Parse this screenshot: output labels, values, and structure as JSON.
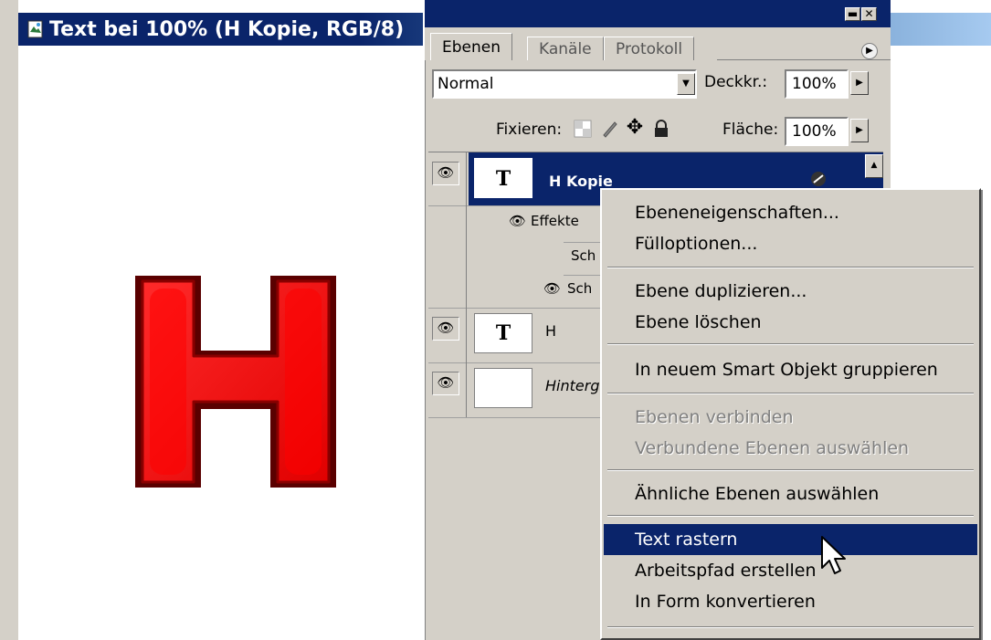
{
  "document": {
    "title": "Text bei 100% (H Kopie, RGB/8)",
    "letter_color": "#ff0000",
    "letter_dark": "#5a0000"
  },
  "palette": {
    "tabs": [
      "Ebenen",
      "Kanäle",
      "Protokoll"
    ],
    "active_tab": "Ebenen",
    "blend_mode": "Normal",
    "opacity_label": "Deckkr.:",
    "opacity_value": "100%",
    "lock_label": "Fixieren:",
    "fill_label": "Fläche:",
    "fill_value": "100%",
    "title_bg": "#0a246a"
  },
  "layers": [
    {
      "name": "H Kopie",
      "thumb": "T",
      "selected": true,
      "effects_label": "Effekte",
      "effects": [
        "Sch",
        "Sch"
      ]
    },
    {
      "name": "H",
      "thumb": "T",
      "selected": false
    },
    {
      "name": "Hinterg",
      "thumb": "",
      "selected": false
    }
  ],
  "context_menu": {
    "items": [
      {
        "label": "Ebeneneigenschaften...",
        "state": "enabled"
      },
      {
        "label": "Fülloptionen...",
        "state": "enabled"
      },
      {
        "label": "Ebene duplizieren...",
        "state": "enabled"
      },
      {
        "label": "Ebene löschen",
        "state": "enabled"
      },
      {
        "label": "In neuem Smart Objekt gruppieren",
        "state": "enabled"
      },
      {
        "label": "Ebenen verbinden",
        "state": "disabled"
      },
      {
        "label": "Verbundene Ebenen auswählen",
        "state": "disabled"
      },
      {
        "label": "Ähnliche Ebenen auswählen",
        "state": "enabled"
      },
      {
        "label": "Text rastern",
        "state": "highlighted"
      },
      {
        "label": "Arbeitspfad erstellen",
        "state": "enabled"
      },
      {
        "label": "In Form konvertieren",
        "state": "enabled"
      }
    ],
    "highlight_color": "#0a246a"
  }
}
